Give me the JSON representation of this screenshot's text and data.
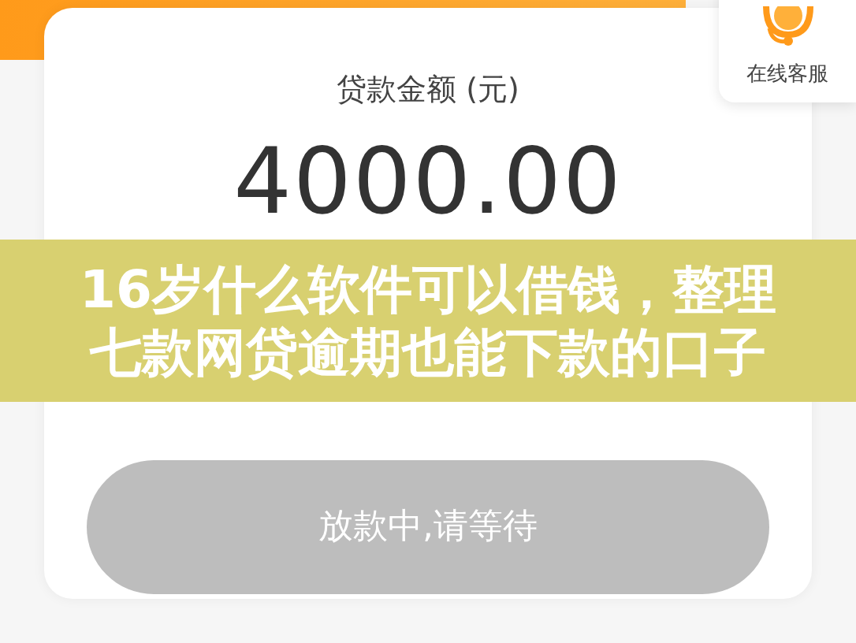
{
  "loan_card": {
    "label": "贷款金额 (元)",
    "amount": "4000.00"
  },
  "support": {
    "label": "在线客服"
  },
  "overlay_title": {
    "lines": [
      "16岁什么软件可以借钱，整理",
      "七款网贷逾期也能下款的口子"
    ]
  },
  "submit_button": {
    "label": "放款中,请等待",
    "disabled": true
  }
}
